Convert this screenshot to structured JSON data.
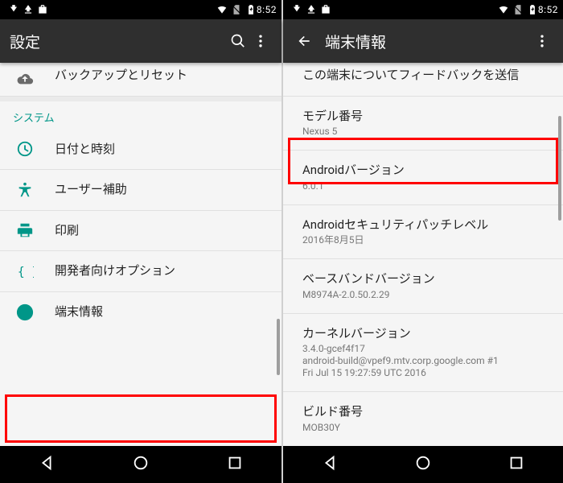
{
  "statusbar": {
    "time": "8:52"
  },
  "left": {
    "title": "設定",
    "backup_row": "バックアップとリセット",
    "section_system": "システム",
    "items": [
      {
        "label": "日付と時刻"
      },
      {
        "label": "ユーザー補助"
      },
      {
        "label": "印刷"
      },
      {
        "label": "開発者向けオプション"
      },
      {
        "label": "端末情報"
      }
    ]
  },
  "right": {
    "title": "端末情報",
    "rows": [
      {
        "primary": "この端末についてフィードバックを送信"
      },
      {
        "primary": "モデル番号",
        "secondary": "Nexus 5"
      },
      {
        "primary": "Androidバージョン",
        "secondary": "6.0.1"
      },
      {
        "primary": "Androidセキュリティパッチレベル",
        "secondary": "2016年8月5日"
      },
      {
        "primary": "ベースバンドバージョン",
        "secondary": "M8974A-2.0.50.2.29"
      },
      {
        "primary": "カーネルバージョン",
        "secondary": "3.4.0-gcef4f17\nandroid-build@vpef9.mtv.corp.google.com #1\nFri Jul 15 19:27:59 UTC 2016"
      },
      {
        "primary": "ビルド番号",
        "secondary": "MOB30Y"
      }
    ]
  }
}
